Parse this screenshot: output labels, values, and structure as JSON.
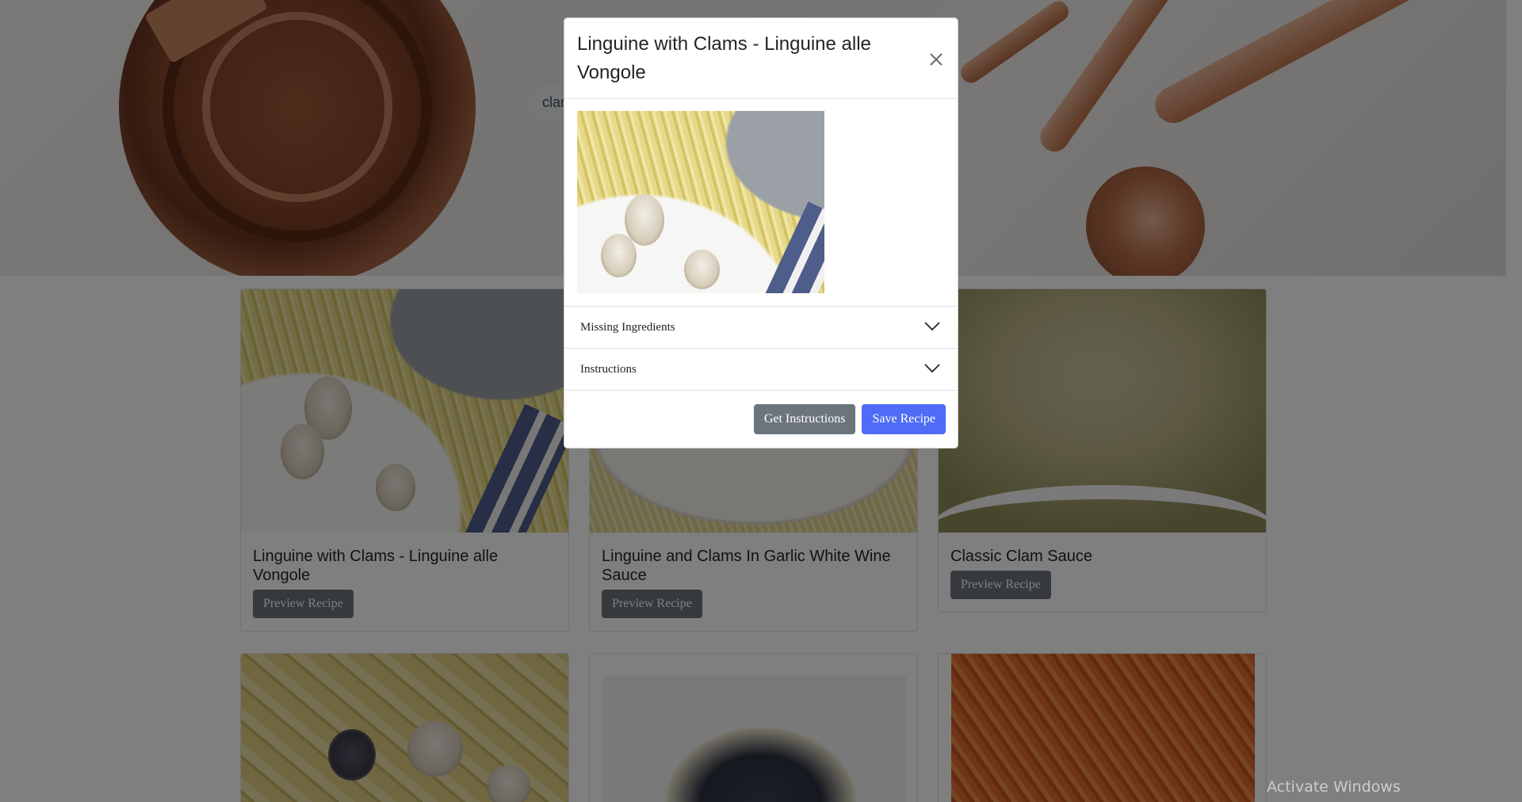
{
  "search": {
    "value": "clams",
    "placeholder": ""
  },
  "recipes": [
    {
      "title": "Linguine with Clams - Linguine alle Vongole",
      "button": "Preview Recipe"
    },
    {
      "title": "Linguine and Clams In Garlic White Wine Sauce",
      "button": "Preview Recipe"
    },
    {
      "title": "Classic Clam Sauce",
      "button": "Preview Recipe"
    }
  ],
  "modal": {
    "title": "Linguine with Clams - Linguine alle Vongole",
    "accordion": [
      {
        "label": "Missing Ingredients"
      },
      {
        "label": "Instructions"
      }
    ],
    "get_instructions_label": "Get Instructions",
    "save_recipe_label": "Save Recipe"
  },
  "watermark": "Activate Windows",
  "colors": {
    "primary": "#4e6cf5",
    "secondary": "#6c757d",
    "backdrop": "rgba(0,0,0,0.5)"
  },
  "icons": [
    "close-icon",
    "chevron-down-icon"
  ]
}
